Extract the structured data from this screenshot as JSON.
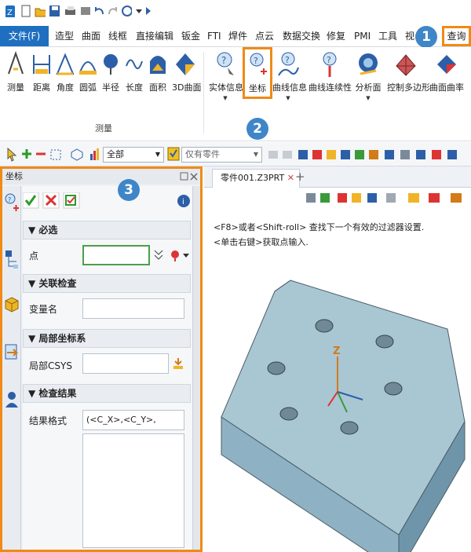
{
  "menubar": {
    "file": "文件(F)",
    "items": [
      "造型",
      "曲面",
      "线框",
      "直接编辑",
      "钣金",
      "FTI",
      "焊件",
      "点云",
      "数据交换",
      "修复",
      "PMI",
      "工具",
      "视"
    ],
    "active": "查询"
  },
  "ribbon": {
    "measure_group": {
      "label": "测量",
      "buttons": [
        "测量",
        "距离",
        "角度",
        "圆弧",
        "半径",
        "长度",
        "面积",
        "3D曲面"
      ]
    },
    "query_buttons": [
      "实体信息",
      "坐标",
      "曲线信息",
      "曲线连续性",
      "分析面",
      "控制多边形",
      "曲面曲率"
    ]
  },
  "toolbar": {
    "filter_value": "全部",
    "filter_parts": "仅有零件"
  },
  "panel": {
    "title": "坐标",
    "sections": {
      "required": "必选",
      "point_label": "点",
      "relation": "关联检查",
      "varname_label": "变量名",
      "local": "局部坐标系",
      "local_label": "局部CSYS",
      "result": "检查结果",
      "format_label": "结果格式",
      "format_value": "(<C_X>,<C_Y>,<C_Z>)"
    }
  },
  "viewport": {
    "tab": "零件001.Z3PRT",
    "hint1": "<F8>或者<Shift-roll> 查找下一个有效的过滤器设置.",
    "hint2": "<单击右键>获取点输入."
  },
  "callouts": [
    "1",
    "2",
    "3"
  ],
  "colors": {
    "accent": "#1f6fc0",
    "highlight": "#f08a16",
    "callout": "#3f86c8",
    "part": "#a9c6d3"
  }
}
